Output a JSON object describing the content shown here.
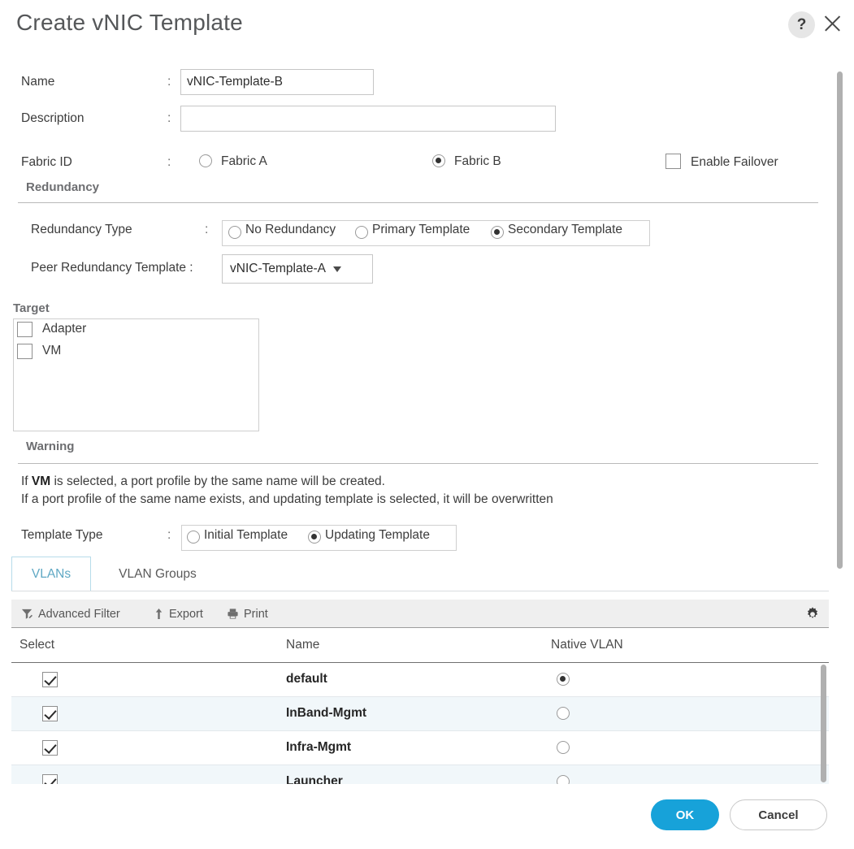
{
  "dialog": {
    "title": "Create vNIC Template",
    "help_icon": "?",
    "help_title": "Help",
    "close_title": "Close"
  },
  "form": {
    "name": {
      "label": "Name",
      "colon": ":",
      "value": "vNIC-Template-B",
      "placeholder": ""
    },
    "description": {
      "label": "Description",
      "colon": ":",
      "value": "",
      "placeholder": ""
    },
    "fabric_id": {
      "label": "Fabric ID",
      "colon": ":",
      "options": [
        {
          "label": "Fabric A",
          "selected": false
        },
        {
          "label": "Fabric B",
          "selected": true
        }
      ],
      "failover": {
        "label": "Enable Failover",
        "checked": false
      }
    }
  },
  "redundancy": {
    "section_title": "Redundancy",
    "type": {
      "label": "Redundancy Type",
      "colon": ":",
      "options": [
        {
          "label": "No Redundancy",
          "selected": false
        },
        {
          "label": "Primary Template",
          "selected": false
        },
        {
          "label": "Secondary Template",
          "selected": true
        }
      ]
    },
    "peer": {
      "label": "Peer Redundancy Template :",
      "value": "vNIC-Template-A"
    }
  },
  "target": {
    "section_title": "Target",
    "items": [
      {
        "label": "Adapter",
        "checked": true
      },
      {
        "label": "VM",
        "checked": false
      }
    ]
  },
  "warning": {
    "section_title": "Warning",
    "line1_pre": "If ",
    "line1_bold": "VM",
    "line1_post": " is selected, a port profile by the same name will be created.",
    "line2": "If a port profile of the same name exists, and updating template is selected, it will be overwritten"
  },
  "template_type": {
    "label": "Template Type",
    "colon": ":",
    "options": [
      {
        "label": "Initial Template",
        "selected": false
      },
      {
        "label": "Updating Template",
        "selected": true
      }
    ]
  },
  "tabs": [
    {
      "label": "VLANs",
      "active": true
    },
    {
      "label": "VLAN Groups",
      "active": false
    }
  ],
  "toolbar": {
    "advanced_filter": "Advanced Filter",
    "export": "Export",
    "print": "Print",
    "settings_title": "Settings"
  },
  "table": {
    "columns": [
      "Select",
      "Name",
      "Native VLAN"
    ],
    "rows": [
      {
        "selected": true,
        "name": "default",
        "native_vlan": true
      },
      {
        "selected": true,
        "name": "InBand-Mgmt",
        "native_vlan": false
      },
      {
        "selected": true,
        "name": "Infra-Mgmt",
        "native_vlan": false
      },
      {
        "selected": true,
        "name": "Launcher",
        "native_vlan": false
      }
    ]
  },
  "footer": {
    "ok": "OK",
    "cancel": "Cancel"
  },
  "colors": {
    "accent_blue": "#17a2d9",
    "tab_active_text": "#5fa8c4",
    "row_alt": "#f1f7fa",
    "title_text": "#555759"
  }
}
